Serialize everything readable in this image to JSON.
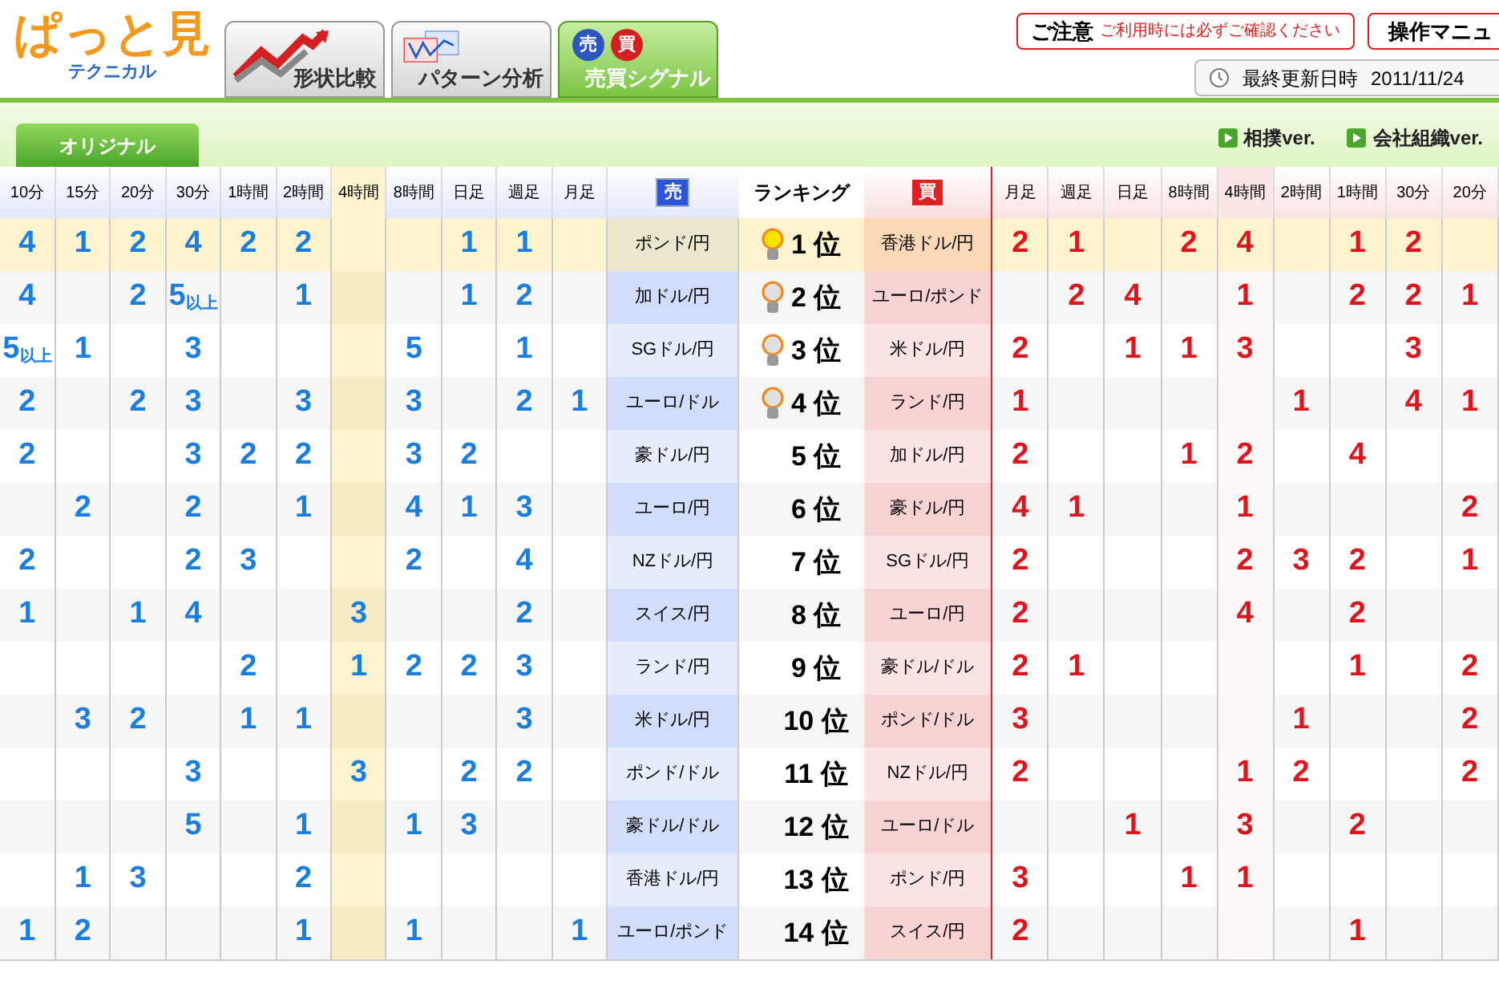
{
  "logo": {
    "title": "ぱっと見",
    "subtitle": "テクニカル"
  },
  "tabs": [
    {
      "label": "形状比較",
      "selected": false,
      "kind": "shape"
    },
    {
      "label": "パターン分析",
      "selected": false,
      "kind": "pattern"
    },
    {
      "label": "売買シグナル",
      "selected": true,
      "kind": "signal",
      "badges": [
        "売",
        "買"
      ]
    }
  ],
  "notice": {
    "title": "ご注意",
    "text": "ご利用時には必ずご確認ください"
  },
  "manual_button": "操作マニュ",
  "last_update": {
    "label": "最終更新日時",
    "value": "2011/11/24"
  },
  "subtabs": [
    {
      "label": "オリジナル",
      "selected": true
    }
  ],
  "versions": [
    "相撲ver.",
    "会社組織ver."
  ],
  "table": {
    "left_columns": [
      {
        "label": "10分",
        "selected": false
      },
      {
        "label": "15分",
        "selected": false
      },
      {
        "label": "20分",
        "selected": false
      },
      {
        "label": "30分",
        "selected": false
      },
      {
        "label": "1時間",
        "selected": false
      },
      {
        "label": "2時間",
        "selected": false
      },
      {
        "label": "4時間",
        "selected": true
      },
      {
        "label": "8時間",
        "selected": false
      },
      {
        "label": "日足",
        "selected": false
      },
      {
        "label": "週足",
        "selected": false
      },
      {
        "label": "月足",
        "selected": false
      }
    ],
    "sell_header": "売",
    "rank_header": "ランキング",
    "buy_header": "買",
    "right_columns": [
      {
        "label": "月足",
        "selected": false
      },
      {
        "label": "週足",
        "selected": false
      },
      {
        "label": "日足",
        "selected": false
      },
      {
        "label": "8時間",
        "selected": false
      },
      {
        "label": "4時間",
        "selected": true
      },
      {
        "label": "2時間",
        "selected": false
      },
      {
        "label": "1時間",
        "selected": false
      },
      {
        "label": "30分",
        "selected": false
      },
      {
        "label": "20分",
        "selected": false
      }
    ],
    "rows": [
      {
        "selected": true,
        "bulb": true,
        "bulb_lit": true,
        "left": {
          "column_1": "4",
          "column_2": "1",
          "column_3": "2",
          "column_4": "4",
          "column_5": "2",
          "column_6": "2",
          "column_9": "1",
          "column_10": "1"
        },
        "sell": "ポンド/円",
        "rank": "1 位",
        "buy": "香港ドル/円",
        "right": {
          "column_1": "2",
          "column_2": "1",
          "column_4": "2",
          "column_5": "4",
          "column_7": "1",
          "column_8": "2"
        }
      },
      {
        "selected": false,
        "bulb": true,
        "bulb_lit": false,
        "left": {
          "column_1": "4",
          "column_3": "2",
          "column_4": "5$_{以上}$",
          "column_6": "1",
          "column_9": "1",
          "column_10": "2"
        },
        "sell": "加ドル/円",
        "rank": "2 位",
        "buy": "ユーロ/ポンド",
        "right": {
          "column_2": "2",
          "column_3": "4",
          "column_5": "1",
          "column_7": "2",
          "column_8": "2",
          "column_9": "1"
        }
      },
      {
        "selected": false,
        "bulb": true,
        "bulb_lit": false,
        "left": {
          "column_1": "5$_{以上}$",
          "column_2": "1",
          "column_4": "3",
          "column_8": "5",
          "column_10": "1"
        },
        "sell": "SGドル/円",
        "rank": "3 位",
        "buy": "米ドル/円",
        "right": {
          "column_1": "2",
          "column_3": "1",
          "column_4": "1",
          "column_5": "3",
          "column_8": "3"
        }
      },
      {
        "selected": false,
        "bulb": true,
        "bulb_lit": false,
        "left": {
          "column_1": "2",
          "column_3": "2",
          "column_4": "3",
          "column_6": "3",
          "column_8": "3",
          "column_10": "2",
          "column_11": "1"
        },
        "sell": "ユーロ/ドル",
        "rank": "4 位",
        "buy": "ランド/円",
        "right": {
          "column_1": "1",
          "column_6": "1",
          "column_8": "4",
          "column_9": "1"
        }
      },
      {
        "selected": false,
        "bulb": false,
        "left": {
          "column_1": "2",
          "column_4": "3",
          "column_5": "2",
          "column_6": "2",
          "column_8": "3",
          "column_9": "2"
        },
        "sell": "豪ドル/円",
        "rank": "5 位",
        "buy": "加ドル/円",
        "right": {
          "column_1": "2",
          "column_4": "1",
          "column_5": "2",
          "column_7": "4"
        }
      },
      {
        "selected": false,
        "bulb": false,
        "left": {
          "column_2": "2",
          "column_4": "2",
          "column_6": "1",
          "column_8": "4",
          "column_9": "1",
          "column_10": "3"
        },
        "sell": "ユーロ/円",
        "rank": "6 位",
        "buy": "豪ドル/円",
        "right": {
          "column_1": "4",
          "column_2": "1",
          "column_5": "1",
          "column_9": "2"
        }
      },
      {
        "selected": false,
        "bulb": false,
        "left": {
          "column_1": "2",
          "column_4": "2",
          "column_5": "3",
          "column_8": "2",
          "column_10": "4"
        },
        "sell": "NZドル/円",
        "rank": "7 位",
        "buy": "SGドル/円",
        "right": {
          "column_1": "2",
          "column_5": "2",
          "column_6": "3",
          "column_7": "2",
          "column_9": "1"
        }
      },
      {
        "selected": false,
        "bulb": false,
        "left": {
          "column_1": "1",
          "column_3": "1",
          "column_4": "4",
          "column_7": "3",
          "column_10": "2"
        },
        "sell": "スイス/円",
        "rank": "8 位",
        "buy": "ユーロ/円",
        "right": {
          "column_1": "2",
          "column_5": "4",
          "column_7": "2"
        }
      },
      {
        "selected": false,
        "bulb": false,
        "left": {
          "column_5": "2",
          "column_7": "1",
          "column_8": "2",
          "column_9": "2",
          "column_10": "3"
        },
        "sell": "ランド/円",
        "rank": "9 位",
        "buy": "豪ドル/ドル",
        "right": {
          "column_1": "2",
          "column_2": "1",
          "column_7": "1",
          "column_9": "2"
        }
      },
      {
        "selected": false,
        "bulb": false,
        "left": {
          "column_2": "3",
          "column_3": "2",
          "column_5": "1",
          "column_6": "1",
          "column_10": "3"
        },
        "sell": "米ドル/円",
        "rank": "10 位",
        "buy": "ポンド/ドル",
        "right": {
          "column_1": "3",
          "column_6": "1",
          "column_9": "2"
        }
      },
      {
        "selected": false,
        "bulb": false,
        "left": {
          "column_4": "3",
          "column_7": "3",
          "column_9": "2",
          "column_10": "2"
        },
        "sell": "ポンド/ドル",
        "rank": "11 位",
        "buy": "NZドル/円",
        "right": {
          "column_1": "2",
          "column_5": "1",
          "column_6": "2",
          "column_9": "2"
        }
      },
      {
        "selected": false,
        "bulb": false,
        "left": {
          "column_4": "5",
          "column_6": "1",
          "column_8": "1",
          "column_9": "3"
        },
        "sell": "豪ドル/ドル",
        "rank": "12 位",
        "buy": "ユーロ/ドル",
        "right": {
          "column_3": "1",
          "column_5": "3",
          "column_7": "2"
        }
      },
      {
        "selected": false,
        "bulb": false,
        "left": {
          "column_2": "1",
          "column_3": "3",
          "column_6": "2"
        },
        "sell": "香港ドル/円",
        "rank": "13 位",
        "buy": "ポンド/円",
        "right": {
          "column_1": "3",
          "column_4": "1",
          "column_5": "1"
        }
      },
      {
        "selected": false,
        "bulb": false,
        "left": {
          "column_1": "1",
          "column_2": "2",
          "column_6": "1",
          "column_8": "1",
          "column_11": "1"
        },
        "sell": "ユーロ/ポンド",
        "rank": "14 位",
        "buy": "スイス/円",
        "right": {
          "column_1": "2",
          "column_7": "1"
        }
      }
    ]
  }
}
